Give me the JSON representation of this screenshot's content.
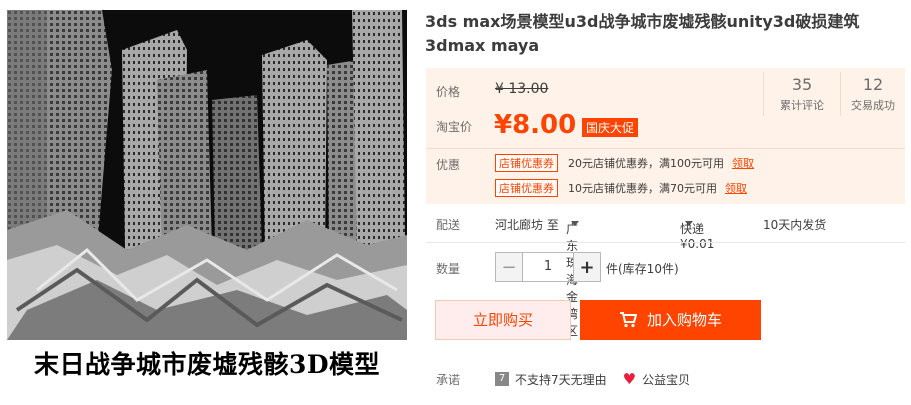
{
  "product_image": {
    "caption": "末日战争城市废墟残骸3D模型"
  },
  "title": "3ds max场景模型u3d战争城市废墟残骸unity3d破损建筑3dmax maya",
  "price": {
    "label": "价格",
    "original": "¥ 13.00",
    "promo_label": "淘宝价",
    "promo": "¥8.00",
    "badge": "国庆大促"
  },
  "stats": [
    {
      "num": "35",
      "label": "累计评论"
    },
    {
      "num": "12",
      "label": "交易成功"
    }
  ],
  "coupons": {
    "label": "优惠",
    "items": [
      {
        "tag": "店铺优惠券",
        "text": "20元店铺优惠券，满100元可用",
        "link": "领取"
      },
      {
        "tag": "店铺优惠券",
        "text": "10元店铺优惠券，满70元可用",
        "link": "领取"
      }
    ]
  },
  "shipping": {
    "label": "配送",
    "from": "河北廊坊 至",
    "to": "广东珠海金湾区",
    "method": "快递 ¥0.01",
    "time": "10天内发货"
  },
  "quantity": {
    "label": "数量",
    "value": "1",
    "stock": "件(库存10件)"
  },
  "buttons": {
    "buy": "立即购买",
    "cart": "加入购物车"
  },
  "promise": {
    "label": "承诺",
    "item1": "不支持7天无理由",
    "item2": "公益宝贝"
  }
}
